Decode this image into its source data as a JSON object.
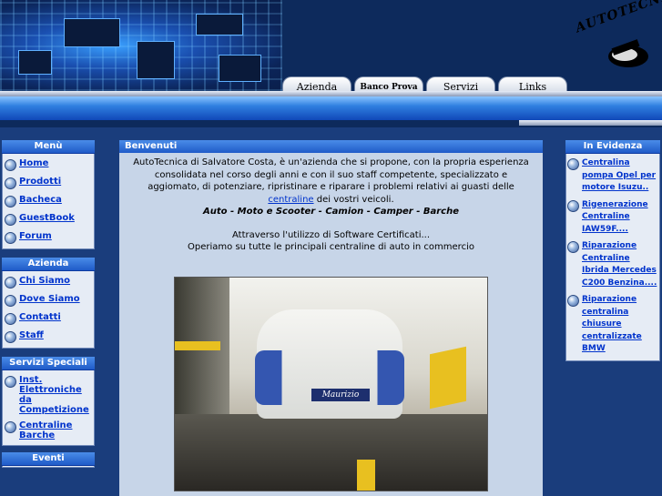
{
  "header": {
    "logo_text": "AUTOTECNICA",
    "tabs": [
      {
        "label": "Azienda"
      },
      {
        "label": "Banco Prova"
      },
      {
        "label": "Servizi"
      },
      {
        "label": "Links"
      }
    ]
  },
  "menu": {
    "title": "Menù",
    "items": [
      {
        "label": "Home"
      },
      {
        "label": "Prodotti"
      },
      {
        "label": "Bacheca"
      },
      {
        "label": "GuestBook"
      },
      {
        "label": "Forum"
      }
    ]
  },
  "azienda": {
    "title": "Azienda",
    "items": [
      {
        "label": "Chi Siamo"
      },
      {
        "label": "Dove Siamo"
      },
      {
        "label": "Contatti"
      },
      {
        "label": "Staff"
      }
    ]
  },
  "servizi": {
    "title": "Servizi Speciali",
    "items": [
      {
        "label": "Inst. Elettroniche da Competizione"
      },
      {
        "label": "Centraline Barche"
      }
    ]
  },
  "eventi": {
    "title": "Eventi"
  },
  "main": {
    "title": "Benvenuti",
    "intro_before": "AutoTecnica di Salvatore Costa, è un'azienda che si propone, con la propria esperienza consolidata nel corso degli anni e con il suo staff competente, specializzato e aggiomato, di potenziare, ripristinare e riparare i problemi relativi ai guasti delle ",
    "intro_link": "centraline",
    "intro_after": " dei vostri veicoli.",
    "categories": "Auto - Moto e Scooter - Camion - Camper - Barche",
    "software_line1": "Attraverso l'utilizzo di Software Certificati...",
    "software_line2": "Operiamo su tutte le principali centraline di auto in commercio",
    "photo_plate": "Maurizio"
  },
  "evidenza": {
    "title": "In Evidenza",
    "items": [
      {
        "label": "Centralina pompa Opel per motore Isuzu.."
      },
      {
        "label": "Rigenerazione Centraline IAW59F...."
      },
      {
        "label": "Riparazione Centraline Ibrida Mercedes C200 Benzina...."
      },
      {
        "label": "Riparazione centralina chiusure centralizzate BMW"
      }
    ]
  }
}
